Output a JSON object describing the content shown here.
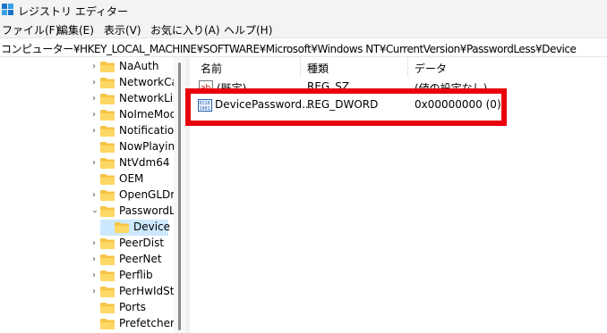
{
  "window": {
    "title": "レジストリ エディター"
  },
  "menu": [
    "ファイル(F)",
    "編集(E)",
    "表示(V)",
    "お気に入り(A)",
    "ヘルプ(H)"
  ],
  "address": "コンピューター¥HKEY_LOCAL_MACHINE¥SOFTWARE¥Microsoft¥Windows NT¥CurrentVersion¥PasswordLess¥Device",
  "tree": [
    {
      "label": "NaAuth",
      "expander": "collapsed"
    },
    {
      "label": "NetworkCa",
      "expander": "collapsed"
    },
    {
      "label": "NetworkLis",
      "expander": "collapsed"
    },
    {
      "label": "NoImeMod",
      "expander": "collapsed"
    },
    {
      "label": "Notification",
      "expander": "collapsed"
    },
    {
      "label": "NowPlaying",
      "expander": "none"
    },
    {
      "label": "NtVdm64",
      "expander": "collapsed"
    },
    {
      "label": "OEM",
      "expander": "none"
    },
    {
      "label": "OpenGLDri",
      "expander": "collapsed"
    },
    {
      "label": "PasswordLe",
      "expander": "expanded"
    },
    {
      "label": "Device",
      "expander": "none",
      "selected": true
    },
    {
      "label": "PeerDist",
      "expander": "collapsed"
    },
    {
      "label": "PeerNet",
      "expander": "collapsed"
    },
    {
      "label": "Perflib",
      "expander": "collapsed"
    },
    {
      "label": "PerHwIdSto",
      "expander": "collapsed"
    },
    {
      "label": "Ports",
      "expander": "none"
    },
    {
      "label": "Prefetcher",
      "expander": "none"
    }
  ],
  "columns": {
    "name": "名前",
    "type": "種類",
    "data": "データ"
  },
  "values": [
    {
      "name": "(既定)",
      "type": "REG_SZ",
      "data": "(値の設定なし)",
      "icon": "string-value-icon"
    },
    {
      "name": "DevicePassword...",
      "type": "REG_DWORD",
      "data": "0x00000000 (0)",
      "icon": "binary-value-icon"
    }
  ],
  "colors": {
    "highlight": "#e8000b",
    "folder": "#f6c343",
    "selection": "#cce8ff"
  }
}
